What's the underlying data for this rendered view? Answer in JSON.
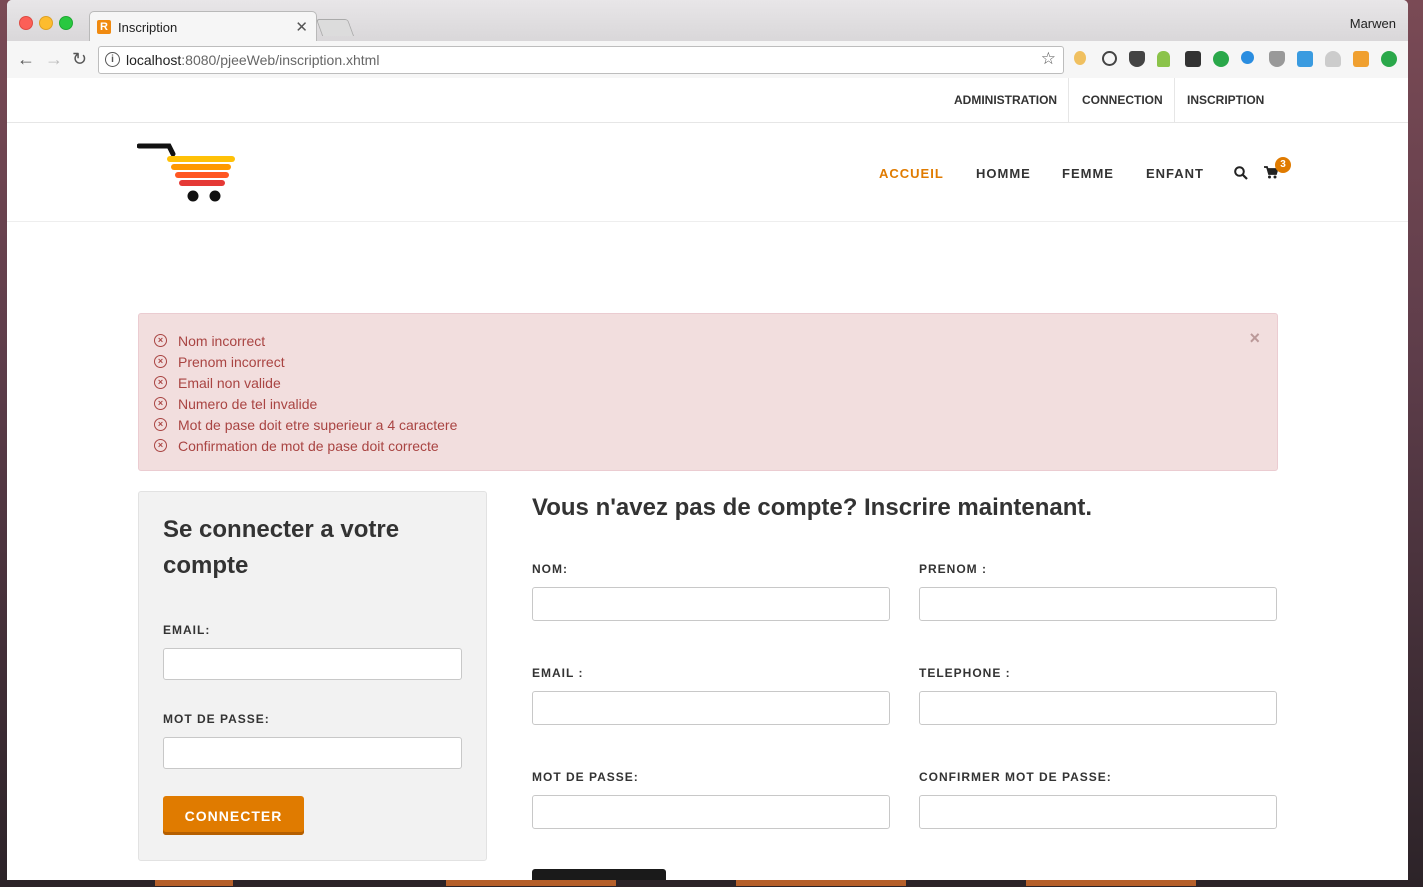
{
  "browser": {
    "tab_title": "Inscription",
    "tab_favicon_letter": "R",
    "user_name": "Marwen",
    "url_host": "localhost",
    "url_path": ":8080/pjeeWeb/inscription.xhtml"
  },
  "topnav": {
    "items": [
      "ADMINISTRATION",
      "CONNECTION",
      "INSCRIPTION"
    ]
  },
  "mainnav": {
    "items": [
      "ACCUEIL",
      "HOMME",
      "FEMME",
      "ENFANT"
    ],
    "active": "ACCUEIL",
    "cart_count": "3"
  },
  "alert": {
    "messages": [
      "Nom incorrect",
      "Prenom incorrect",
      "Email non valide",
      "Numero de tel invalide",
      "Mot de pase doit etre superieur a 4 caractere",
      "Confirmation de mot de pase doit correcte"
    ],
    "dismiss": "×"
  },
  "login": {
    "title": "Se connecter a votre compte",
    "email_label": "EMAIL:",
    "email_value": "",
    "password_label": "MOT DE PASSE:",
    "password_value": "",
    "submit_label": "CONNECTER"
  },
  "register": {
    "title": "Vous n'avez pas de compte? Inscrire maintenant.",
    "nom_label": "NOM:",
    "prenom_label": "PRENOM :",
    "email_label": "EMAIL :",
    "telephone_label": "TELEPHONE :",
    "password_label": "MOT DE PASSE:",
    "confirm_label": "CONFIRMER MOT DE PASSE:"
  },
  "colors": {
    "accent": "#e07b00",
    "alert_bg": "#f2dede",
    "alert_text": "#a94442"
  }
}
